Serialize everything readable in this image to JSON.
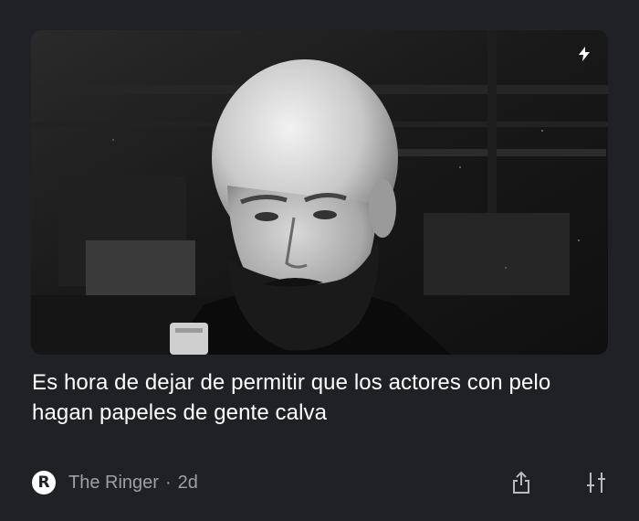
{
  "article": {
    "image_alt": "Bald bearded man in a dark room",
    "headline": "Es hora de dejar de permitir que los actores con pelo hagan papeles de gente calva",
    "source": "The Ringer",
    "separator": "·",
    "age": "2d"
  },
  "source_logo": {
    "letter": "R"
  },
  "icons": {
    "badge": "lightning-icon",
    "share": "share-icon",
    "options": "sliders-icon"
  },
  "colors": {
    "background": "#202124",
    "headline": "#ffffff",
    "meta": "#9aa0a6"
  }
}
